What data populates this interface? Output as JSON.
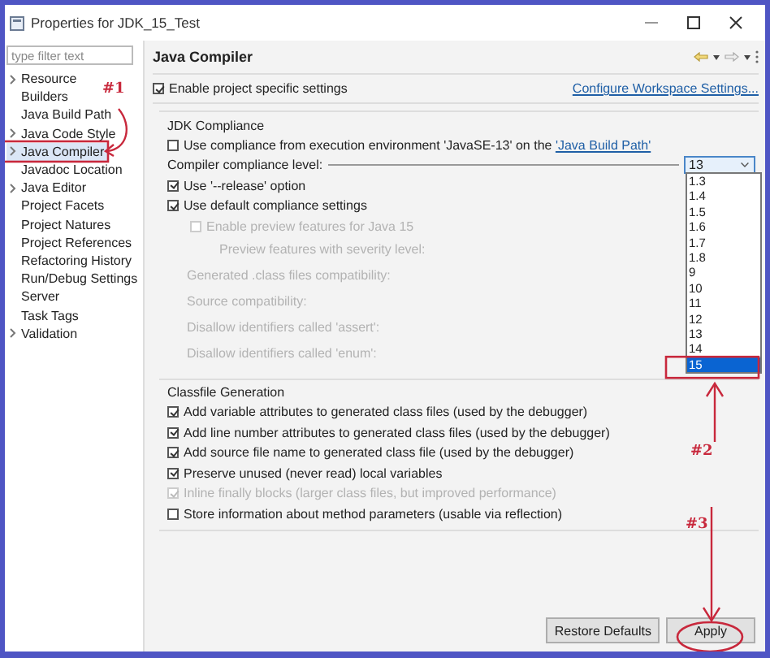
{
  "window": {
    "title": "Properties for JDK_15_Test"
  },
  "filter": {
    "placeholder": "type filter text"
  },
  "tree": [
    {
      "label": "Resource",
      "expandable": true,
      "selected": false
    },
    {
      "label": "Builders",
      "expandable": false,
      "selected": false
    },
    {
      "label": "Java Build Path",
      "expandable": false,
      "selected": false
    },
    {
      "label": "Java Code Style",
      "expandable": true,
      "selected": false
    },
    {
      "label": "Java Compiler",
      "expandable": true,
      "selected": true
    },
    {
      "label": "Javadoc Location",
      "expandable": false,
      "selected": false
    },
    {
      "label": "Java Editor",
      "expandable": true,
      "selected": false
    },
    {
      "label": "Project Facets",
      "expandable": false,
      "selected": false
    },
    {
      "label": "Project Natures",
      "expandable": false,
      "selected": false
    },
    {
      "label": "Project References",
      "expandable": false,
      "selected": false
    },
    {
      "label": "Refactoring History",
      "expandable": false,
      "selected": false
    },
    {
      "label": "Run/Debug Settings",
      "expandable": false,
      "selected": false
    },
    {
      "label": "Server",
      "expandable": false,
      "selected": false
    },
    {
      "label": "Task Tags",
      "expandable": false,
      "selected": false
    },
    {
      "label": "Validation",
      "expandable": true,
      "selected": false
    }
  ],
  "page": {
    "title": "Java Compiler",
    "enable": {
      "label": "Enable project specific settings",
      "checked": true
    },
    "configure_link": "Configure Workspace Settings..."
  },
  "jdk_compliance": {
    "title": "JDK Compliance",
    "use_environment": {
      "label": "Use compliance from execution environment 'JavaSE-13' on the ",
      "link": "'Java Build Path'",
      "checked": false
    },
    "level": {
      "label": "Compiler compliance level:",
      "value": "13"
    },
    "options": [
      {
        "kind": "checkbox",
        "label": "Use '--release' option",
        "checked": true,
        "disabled": false
      },
      {
        "kind": "checkbox",
        "label": "Use default compliance settings",
        "checked": true,
        "disabled": false,
        "children": [
          {
            "kind": "checkbox",
            "label": "Enable preview features for Java 15",
            "checked": false,
            "disabled": true,
            "children": [
              {
                "kind": "label",
                "label": "Preview features with severity level:",
                "disabled": true
              }
            ]
          }
        ]
      },
      {
        "kind": "label",
        "label": "Generated .class files compatibility:",
        "disabled": true
      },
      {
        "kind": "label",
        "label": "Source compatibility:",
        "disabled": true
      },
      {
        "kind": "label",
        "label": "Disallow identifiers called 'assert':",
        "disabled": true
      },
      {
        "kind": "label",
        "label": "Disallow identifiers called 'enum':",
        "disabled": true
      }
    ]
  },
  "level_options": [
    {
      "label": "1.3",
      "selected": false
    },
    {
      "label": "1.4",
      "selected": false
    },
    {
      "label": "1.5",
      "selected": false
    },
    {
      "label": "1.6",
      "selected": false
    },
    {
      "label": "1.7",
      "selected": false
    },
    {
      "label": "1.8",
      "selected": false
    },
    {
      "label": "9",
      "selected": false
    },
    {
      "label": "10",
      "selected": false
    },
    {
      "label": "11",
      "selected": false
    },
    {
      "label": "12",
      "selected": false
    },
    {
      "label": "13",
      "selected": false
    },
    {
      "label": "14",
      "selected": false
    },
    {
      "label": "15",
      "selected": true
    }
  ],
  "classfile": {
    "title": "Classfile Generation",
    "options": [
      {
        "label": "Add variable attributes to generated class files (used by the debugger)",
        "checked": true,
        "disabled": false
      },
      {
        "label": "Add line number attributes to generated class files (used by the debugger)",
        "checked": true,
        "disabled": false
      },
      {
        "label": "Add source file name to generated class file (used by the debugger)",
        "checked": true,
        "disabled": false
      },
      {
        "label": "Preserve unused (never read) local variables",
        "checked": true,
        "disabled": false
      },
      {
        "label": "Inline finally blocks (larger class files, but improved performance)",
        "checked": true,
        "disabled": true
      },
      {
        "label": "Store information about method parameters (usable via reflection)",
        "checked": false,
        "disabled": false
      }
    ]
  },
  "buttons": [
    {
      "label": "Restore Defaults"
    },
    {
      "label": "Apply"
    }
  ],
  "annotations": [
    {
      "text": "#1"
    },
    {
      "text": "#2"
    },
    {
      "text": "#3"
    }
  ]
}
